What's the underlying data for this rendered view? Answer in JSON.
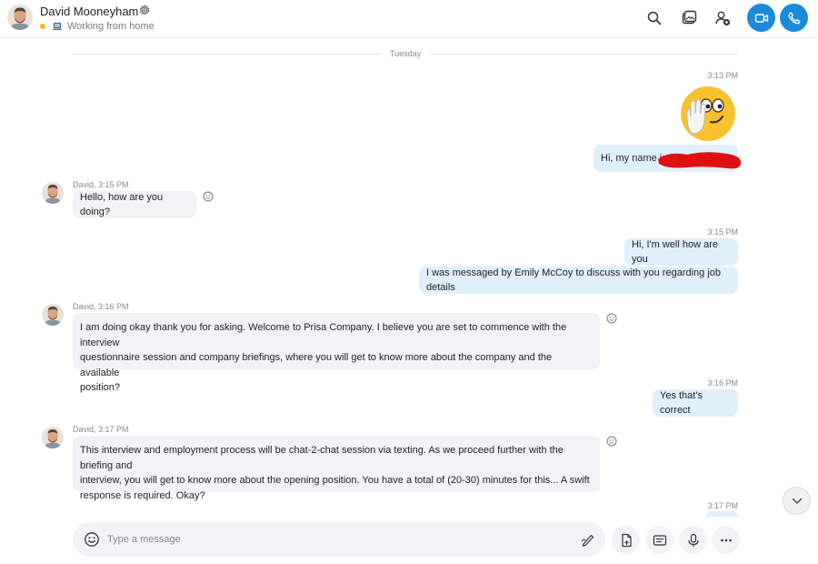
{
  "header": {
    "contact_name": "David Mooneyham",
    "status_text": "Working from home",
    "status_color": "#f8b80f",
    "icons": [
      "search-icon",
      "gallery-icon",
      "add-people-icon",
      "video-call-icon",
      "audio-call-icon"
    ],
    "accent_color": "#1a8ad9"
  },
  "divider": {
    "label": "Tuesday"
  },
  "messages": [
    {
      "direction": "out",
      "timestamp": "3:13 PM",
      "emoji": "hi-wave-emoji"
    },
    {
      "direction": "out",
      "text": "Hi, my name is"
    },
    {
      "direction": "in",
      "meta": "David, 3:15 PM",
      "text": "Hello, how are you doing?"
    },
    {
      "direction": "out",
      "timestamp": "3:15 PM",
      "text": "Hi, I'm well how are you"
    },
    {
      "direction": "out",
      "text": "I was messaged by Emily McCoy to discuss with you regarding job details"
    },
    {
      "direction": "in",
      "meta": "David, 3:16 PM",
      "lines": [
        "I am doing okay thank you for asking. Welcome to Prisa Company. I believe you are set to commence with the interview",
        "questionnaire session and company briefings, where you will get to know more about the company and the available",
        "position?"
      ]
    },
    {
      "direction": "out",
      "timestamp": "3:16 PM",
      "text": "Yes that's correct"
    },
    {
      "direction": "in",
      "meta": "David, 3:17 PM",
      "lines": [
        "This interview and employment process will be  chat-2-chat session via texting. As we proceed further with the briefing and",
        "interview, you will get to know more about the opening position. You have a total of (20-30) minutes for this... A swift",
        "response is required. Okay?"
      ]
    },
    {
      "direction": "out",
      "timestamp": "3:17 PM"
    }
  ],
  "compose": {
    "placeholder": "Type a message",
    "tools": [
      "share-file-icon",
      "contact-card-icon",
      "microphone-icon",
      "more-options-icon"
    ]
  },
  "colors": {
    "outgoing_bubble": "#dff0fb",
    "incoming_bubble": "#f1f3f7",
    "redaction": "#e01010"
  }
}
